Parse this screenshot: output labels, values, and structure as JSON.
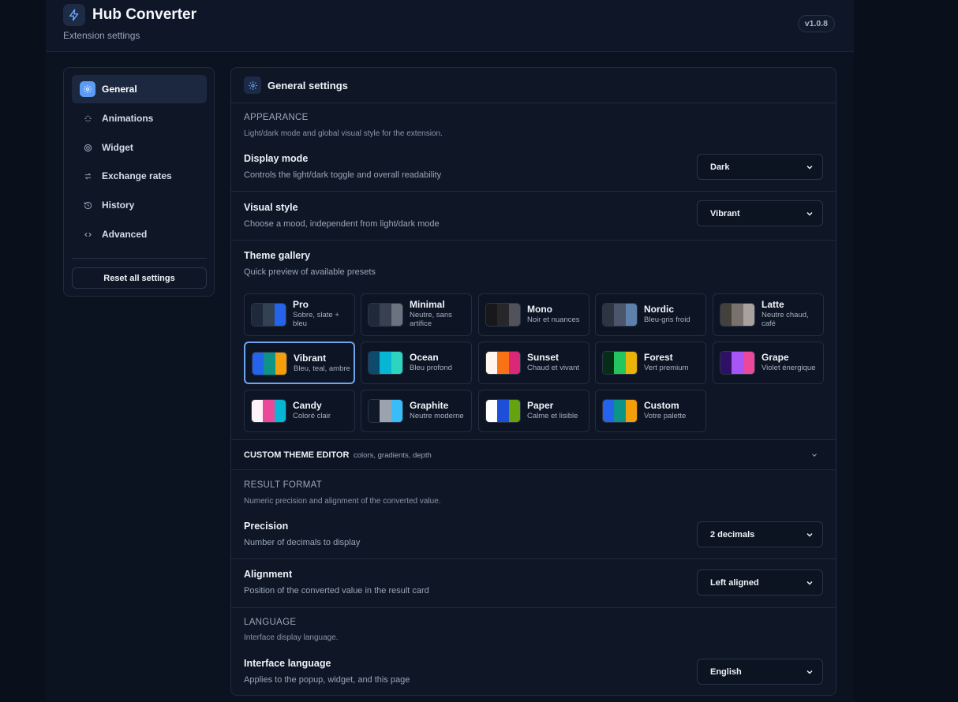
{
  "app": {
    "title": "Hub Converter",
    "subtitle": "Extension settings",
    "version": "v1.0.8",
    "accent": "#5a9cf5"
  },
  "sidebar": {
    "items": [
      {
        "label": "General",
        "icon": "gear-icon",
        "active": true
      },
      {
        "label": "Animations",
        "icon": "sparkle-icon"
      },
      {
        "label": "Widget",
        "icon": "target-icon"
      },
      {
        "label": "Exchange rates",
        "icon": "swap-icon"
      },
      {
        "label": "History",
        "icon": "history-icon"
      },
      {
        "label": "Advanced",
        "icon": "code-icon"
      }
    ],
    "reset_label": "Reset all settings"
  },
  "panel": {
    "title": "General settings",
    "appearance": {
      "section_title": "APPEARANCE",
      "section_desc": "Light/dark mode and global visual style for the extension.",
      "display_mode": {
        "title": "Display mode",
        "desc": "Controls the light/dark toggle and overall readability",
        "value": "Dark"
      },
      "visual_style": {
        "title": "Visual style",
        "desc": "Choose a mood, independent from light/dark mode",
        "value": "Vibrant"
      }
    },
    "gallery": {
      "title": "Theme gallery",
      "desc": "Quick preview of available presets",
      "themes": [
        {
          "name": "Pro",
          "desc": "Sobre, slate + bleu",
          "colors": [
            "#1e293b",
            "#334155",
            "#2563eb"
          ]
        },
        {
          "name": "Minimal",
          "desc": "Neutre, sans artifice",
          "colors": [
            "#1f2937",
            "#374151",
            "#6b7280"
          ]
        },
        {
          "name": "Mono",
          "desc": "Noir et nuances",
          "colors": [
            "#18181b",
            "#27272a",
            "#52525b"
          ]
        },
        {
          "name": "Nordic",
          "desc": "Bleu-gris froid",
          "colors": [
            "#2e3440",
            "#4c566a",
            "#5e81ac"
          ]
        },
        {
          "name": "Latte",
          "desc": "Neutre chaud, café",
          "colors": [
            "#44403c",
            "#78716c",
            "#a8a29e"
          ]
        },
        {
          "name": "Vibrant",
          "desc": "Bleu, teal, ambre",
          "colors": [
            "#2563eb",
            "#0d9488",
            "#f59e0b"
          ],
          "selected": true
        },
        {
          "name": "Ocean",
          "desc": "Bleu profond",
          "colors": [
            "#0c4a6e",
            "#06b6d4",
            "#2dd4bf"
          ]
        },
        {
          "name": "Sunset",
          "desc": "Chaud et vivant",
          "colors": [
            "#fff7ed",
            "#f97316",
            "#db2777"
          ]
        },
        {
          "name": "Forest",
          "desc": "Vert premium",
          "colors": [
            "#052e16",
            "#22c55e",
            "#eab308"
          ]
        },
        {
          "name": "Grape",
          "desc": "Violet énergique",
          "colors": [
            "#2e1065",
            "#a855f7",
            "#ec4899"
          ]
        },
        {
          "name": "Candy",
          "desc": "Coloré clair",
          "colors": [
            "#fdf2f8",
            "#ec4899",
            "#06b6d4"
          ]
        },
        {
          "name": "Graphite",
          "desc": "Neutre moderne",
          "colors": [
            "#111827",
            "#9ca3af",
            "#38bdf8"
          ]
        },
        {
          "name": "Paper",
          "desc": "Calme et lisible",
          "colors": [
            "#ffffff",
            "#1d4ed8",
            "#65a30d"
          ]
        },
        {
          "name": "Custom",
          "desc": "Votre palette",
          "colors": [
            "#2563eb",
            "#0d9488",
            "#f59e0b"
          ]
        }
      ]
    },
    "editor": {
      "title": "CUSTOM THEME EDITOR",
      "hint": "colors, gradients, depth"
    },
    "result_format": {
      "section_title": "RESULT FORMAT",
      "section_desc": "Numeric precision and alignment of the converted value.",
      "precision": {
        "title": "Precision",
        "desc": "Number of decimals to display",
        "value": "2 decimals"
      },
      "alignment": {
        "title": "Alignment",
        "desc": "Position of the converted value in the result card",
        "value": "Left aligned"
      }
    },
    "language": {
      "section_title": "LANGUAGE",
      "section_desc": "Interface display language.",
      "interface_language": {
        "title": "Interface language",
        "desc": "Applies to the popup, widget, and this page",
        "value": "English"
      }
    }
  }
}
